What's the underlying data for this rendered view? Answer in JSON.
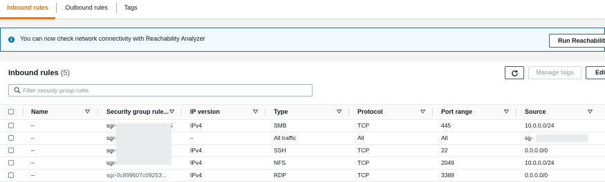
{
  "tabs": [
    {
      "label": "Inbound rules",
      "active": true
    },
    {
      "label": "Outbound rules",
      "active": false
    },
    {
      "label": "Tags",
      "active": false
    }
  ],
  "banner": {
    "icon": "info-icon",
    "text": "You can now check network connectivity with Reachability Analyzer",
    "button": "Run Reachability"
  },
  "panel": {
    "title": "Inbound rules",
    "count": "(5)",
    "refresh_icon": "refresh-icon",
    "manage_tags": "Manage tags",
    "edit": "Edit",
    "search_placeholder": "Filter security group rules"
  },
  "table": {
    "columns": [
      "Name",
      "Security group rule...",
      "IP version",
      "Type",
      "Protocol",
      "Port range",
      "Source"
    ],
    "rows": [
      {
        "name": "–",
        "rule_id": "sgr-",
        "rule_tail": "5",
        "ip": "IPv4",
        "type": "SMB",
        "protocol": "TCP",
        "port": "445",
        "source": "10.0.0.0/24"
      },
      {
        "name": "–",
        "rule_id": "sgr-",
        "rule_tail": "",
        "ip": "–",
        "type": "All traffic",
        "protocol": "All",
        "port": "All",
        "source": "sg-"
      },
      {
        "name": "–",
        "rule_id": "sgr-",
        "rule_tail": "",
        "ip": "IPv4",
        "type": "SSH",
        "protocol": "TCP",
        "port": "22",
        "source": "0.0.0.0/0"
      },
      {
        "name": "–",
        "rule_id": "sgr-",
        "rule_tail": "",
        "ip": "IPv4",
        "type": "NFS",
        "protocol": "TCP",
        "port": "2049",
        "source": "10.0.0.0/24"
      },
      {
        "name": "–",
        "rule_id": "sgr-0c899607c09253...",
        "rule_tail": "",
        "ip": "IPv4",
        "type": "RDP",
        "protocol": "TCP",
        "port": "3389",
        "source": "0.0.0.0/0"
      }
    ]
  },
  "colors": {
    "accent": "#ec7211",
    "info": "#0073bb"
  }
}
